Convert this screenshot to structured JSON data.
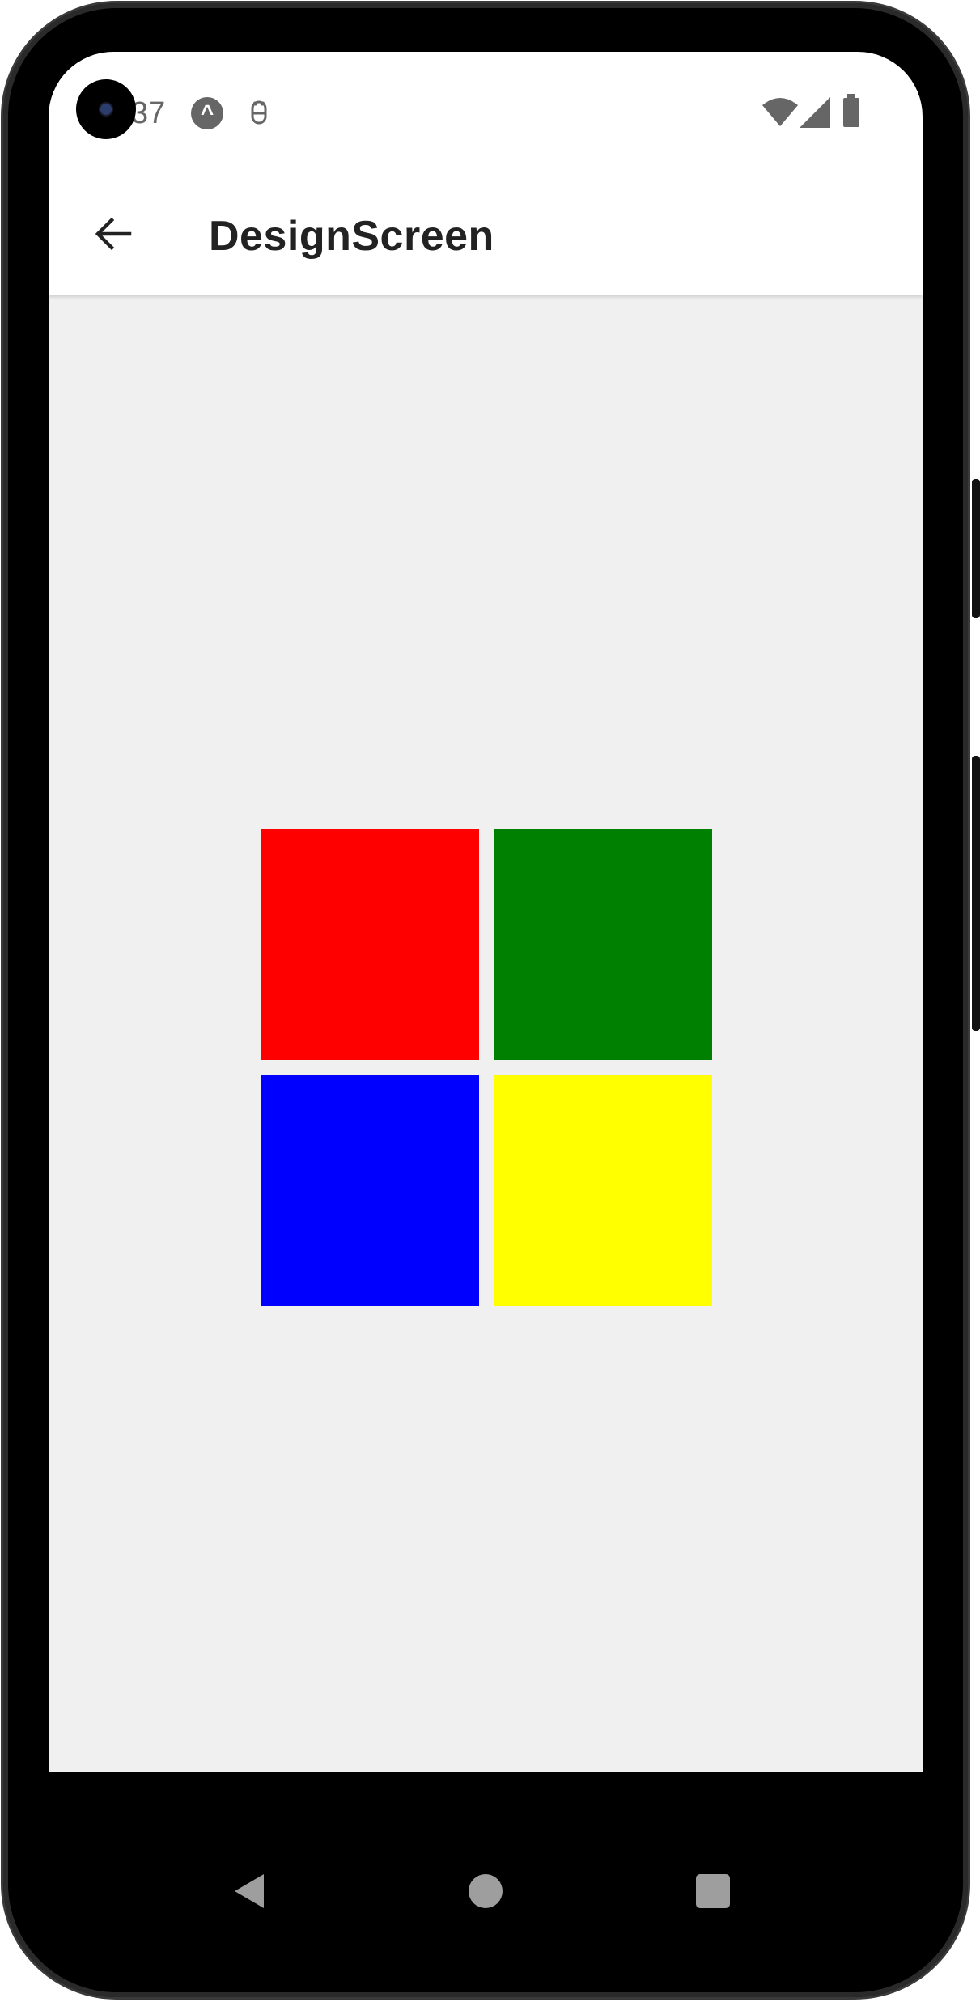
{
  "status_bar": {
    "time_fragment": "37",
    "notification_icons": [
      "expo-go-icon",
      "android-debug-icon"
    ],
    "system_icons": [
      "wifi-icon",
      "cell-signal-icon",
      "battery-icon"
    ]
  },
  "app_bar": {
    "title": "DesignScreen",
    "back_icon": "arrow-left-icon"
  },
  "content": {
    "tiles": [
      {
        "name": "red-tile",
        "color": "#ff0000"
      },
      {
        "name": "green-tile",
        "color": "#008000"
      },
      {
        "name": "blue-tile",
        "color": "#0000ff"
      },
      {
        "name": "yellow-tile",
        "color": "#ffff00"
      }
    ],
    "background_color": "#f0f0f0"
  },
  "navigation_bar": {
    "buttons": [
      "nav-back-icon",
      "nav-home-icon",
      "nav-recents-icon"
    ]
  }
}
